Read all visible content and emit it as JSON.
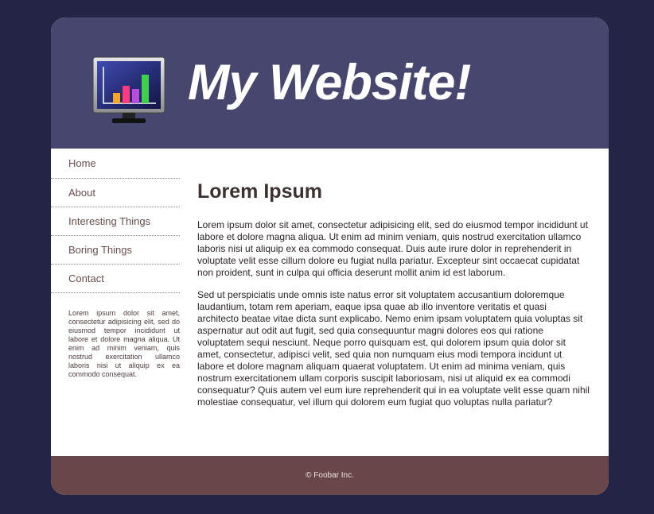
{
  "header": {
    "site_title": "My Website!",
    "logo_icon": "monitor-bar-chart-icon"
  },
  "sidebar": {
    "nav_items": [
      {
        "label": "Home"
      },
      {
        "label": "About"
      },
      {
        "label": "Interesting Things"
      },
      {
        "label": "Boring Things"
      },
      {
        "label": "Contact"
      }
    ],
    "text": "Lorem ipsum dolor sit amet, consectetur adipisicing elit, sed do eiusmod tempor incididunt ut labore et dolore magna aliqua. Ut enim ad minim veniam, quis nostrud exercitation ullamco laboris nisi ut aliquip ex ea commodo consequat."
  },
  "main": {
    "heading": "Lorem Ipsum",
    "paragraphs": [
      "Lorem ipsum dolor sit amet, consectetur adipisicing elit, sed do eiusmod tempor incididunt ut labore et dolore magna aliqua. Ut enim ad minim veniam, quis nostrud exercitation ullamco laboris nisi ut aliquip ex ea commodo consequat. Duis aute irure dolor in reprehenderit in voluptate velit esse cillum dolore eu fugiat nulla pariatur. Excepteur sint occaecat cupidatat non proident, sunt in culpa qui officia deserunt mollit anim id est laborum.",
      "Sed ut perspiciatis unde omnis iste natus error sit voluptatem accusantium doloremque laudantium, totam rem aperiam, eaque ipsa quae ab illo inventore veritatis et quasi architecto beatae vitae dicta sunt explicabo. Nemo enim ipsam voluptatem quia voluptas sit aspernatur aut odit aut fugit, sed quia consequuntur magni dolores eos qui ratione voluptatem sequi nesciunt. Neque porro quisquam est, qui dolorem ipsum quia dolor sit amet, consectetur, adipisci velit, sed quia non numquam eius modi tempora incidunt ut labore et dolore magnam aliquam quaerat voluptatem. Ut enim ad minima veniam, quis nostrum exercitationem ullam corporis suscipit laboriosam, nisi ut aliquid ex ea commodi consequatur? Quis autem vel eum iure reprehenderit qui in ea voluptate velit esse quam nihil molestiae consequatur, vel illum qui dolorem eum fugiat quo voluptas nulla pariatur?"
    ]
  },
  "footer": {
    "copyright": "© Foobar Inc."
  },
  "colors": {
    "background": "#232446",
    "header": "#46466f",
    "footer": "#694749",
    "nav_text": "#6a4e4e"
  }
}
